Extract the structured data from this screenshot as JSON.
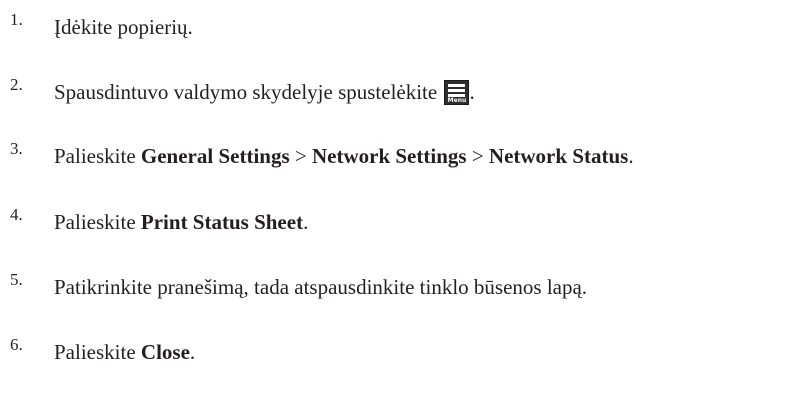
{
  "steps": [
    {
      "number": "1.",
      "text": "Įdėkite popierių."
    },
    {
      "number": "2.",
      "text_before": "Spausdintuvo valdymo skydelyje spustelėkite ",
      "text_after": ".",
      "icon": "menu-icon",
      "icon_label": "Menu"
    },
    {
      "number": "3.",
      "prefix": "Palieskite ",
      "b1": "General Settings",
      "sep1": " > ",
      "b2": "Network Settings",
      "sep2": " > ",
      "b3": "Network Status",
      "suffix": "."
    },
    {
      "number": "4.",
      "prefix": "Palieskite ",
      "b1": "Print Status Sheet",
      "suffix": "."
    },
    {
      "number": "5.",
      "text": "Patikrinkite pranešimą, tada atspausdinkite tinklo būsenos lapą."
    },
    {
      "number": "6.",
      "prefix": "Palieskite ",
      "b1": "Close",
      "suffix": "."
    }
  ]
}
